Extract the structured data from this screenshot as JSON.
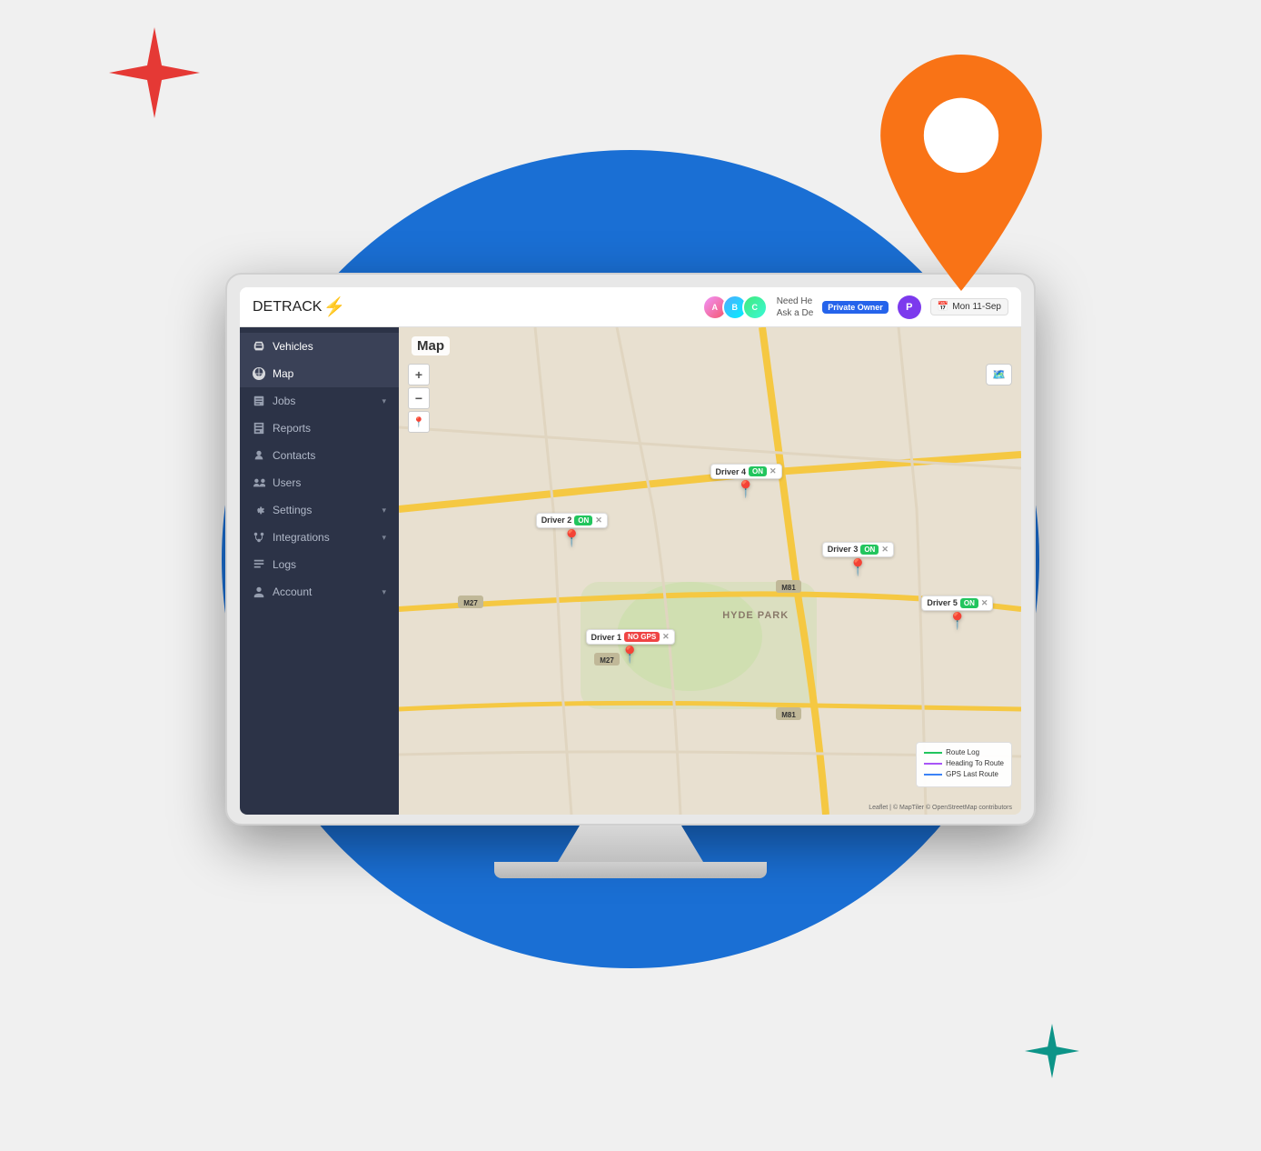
{
  "decorative": {
    "bg_circle_color": "#1a6fd4",
    "star_red_color": "#e53935",
    "star_teal_color": "#0d9488",
    "pin_color": "#f97316"
  },
  "topbar": {
    "logo": "DETRACK",
    "help_line1": "Need He",
    "help_line2": "Ask a De",
    "date": "Mon 11-Sep",
    "user_badge": "Private Owner",
    "user_initial": "P"
  },
  "sidebar": {
    "items": [
      {
        "id": "vehicles",
        "label": "Vehicles",
        "icon": "vehicle",
        "active": false,
        "has_arrow": false
      },
      {
        "id": "map",
        "label": "Map",
        "icon": "map",
        "active": true,
        "has_arrow": false
      },
      {
        "id": "jobs",
        "label": "Jobs",
        "icon": "jobs",
        "active": false,
        "has_arrow": true
      },
      {
        "id": "reports",
        "label": "Reports",
        "icon": "reports",
        "active": false,
        "has_arrow": false
      },
      {
        "id": "contacts",
        "label": "Contacts",
        "icon": "contacts",
        "active": false,
        "has_arrow": false
      },
      {
        "id": "users",
        "label": "Users",
        "icon": "users",
        "active": false,
        "has_arrow": false
      },
      {
        "id": "settings",
        "label": "Settings",
        "icon": "settings",
        "active": false,
        "has_arrow": true
      },
      {
        "id": "integrations",
        "label": "Integrations",
        "icon": "integrations",
        "active": false,
        "has_arrow": true
      },
      {
        "id": "logs",
        "label": "Logs",
        "icon": "logs",
        "active": false,
        "has_arrow": false
      },
      {
        "id": "account",
        "label": "Account",
        "icon": "account",
        "active": false,
        "has_arrow": true
      }
    ]
  },
  "map": {
    "title": "Map",
    "zoom_in": "+",
    "zoom_out": "−",
    "area_label": "HYDE PARK",
    "drivers": [
      {
        "id": "driver1",
        "label": "Driver 1",
        "status": "NO GPS",
        "status_type": "no_gps",
        "top": "62%",
        "left": "30%"
      },
      {
        "id": "driver2",
        "label": "Driver 2",
        "status": "ON",
        "status_type": "on",
        "top": "38%",
        "left": "22%"
      },
      {
        "id": "driver3",
        "label": "Driver 3",
        "status": "ON",
        "status_type": "on",
        "top": "44%",
        "left": "68%"
      },
      {
        "id": "driver4",
        "label": "Driver 4",
        "status": "ON",
        "status_type": "on",
        "top": "28%",
        "left": "50%"
      },
      {
        "id": "driver5",
        "label": "Driver 5",
        "status": "ON",
        "status_type": "on",
        "top": "55%",
        "left": "84%"
      }
    ],
    "legend": [
      {
        "label": "Route Log",
        "color": "#22c55e"
      },
      {
        "label": "Heading To Route",
        "color": "#a855f7"
      },
      {
        "label": "GPS Last Route",
        "color": "#3b82f6"
      }
    ],
    "attribution": "Leaflet | © MapTiler © OpenStreetMap contributors"
  }
}
